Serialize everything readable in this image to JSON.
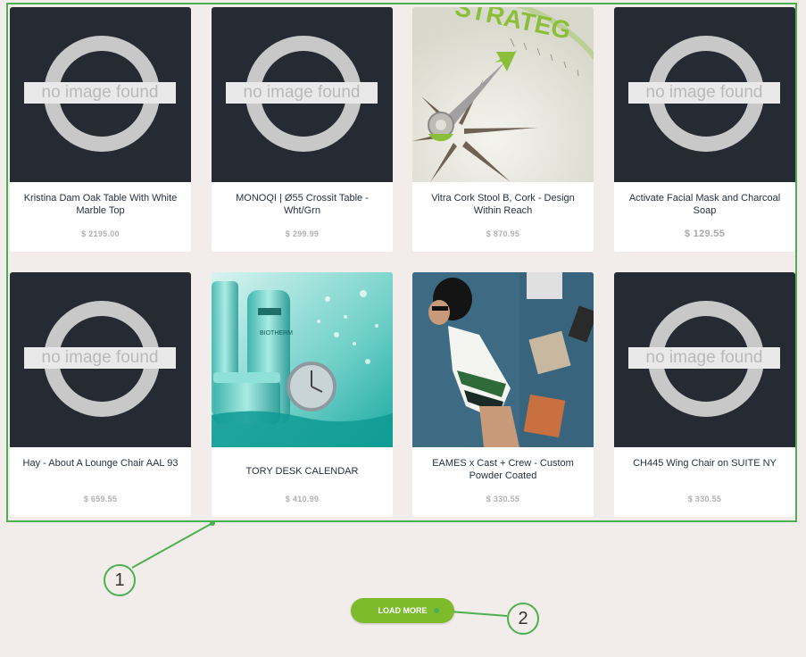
{
  "products": [
    {
      "title": "Kristina Dam Oak Table With White Marble Top",
      "price": "$ 2195.00",
      "image": "no-image-placeholder"
    },
    {
      "title": "MONOQI | Ø55 Crossit Table - Wht/Grn",
      "price": "$ 299.99",
      "image": "no-image-placeholder"
    },
    {
      "title": "Vitra Cork Stool B, Cork - Design Within Reach",
      "price": "$ 870.95",
      "image": "strategy-compass-photo",
      "image_text": "STRATEG"
    },
    {
      "title": "Activate Facial Mask and Charcoal Soap",
      "price": "$ 129.55",
      "image": "no-image-placeholder"
    },
    {
      "title": "Hay - About A Lounge Chair AAL 93",
      "price": "$ 659.55",
      "image": "no-image-placeholder"
    },
    {
      "title": "TORY DESK CALENDAR",
      "price": "$ 410.99",
      "image": "biotherm-aquasource-ad",
      "image_text": "BIOTHERM"
    },
    {
      "title": "EAMES x Cast + Crew - Custom Powder Coated",
      "price": "$ 330.55",
      "image": "fashion-woman-shopping-bags-photo"
    },
    {
      "title": "CH445 Wing Chair on SUITE NY",
      "price": "$ 330.55",
      "image": "no-image-placeholder"
    }
  ],
  "placeholder_text": "no image found",
  "load_more_label": "LOAD MORE",
  "callouts": [
    "1",
    "2"
  ],
  "colors": {
    "accent_green": "#7dbb2c",
    "annotation_green": "#4caf50",
    "card_image_bg": "#252a33",
    "page_bg": "#f2edea"
  }
}
